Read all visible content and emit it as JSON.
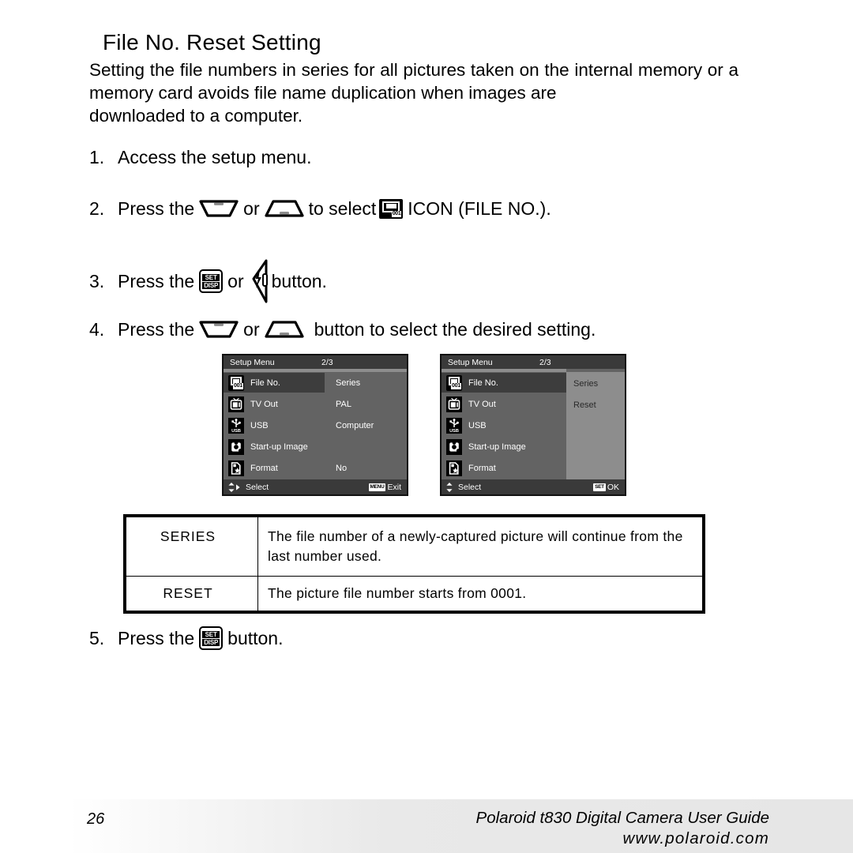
{
  "page": {
    "title": "File No. Reset Setting",
    "intro": "Setting the file numbers in series for all pictures taken on the internal memory or a memory card avoids file name duplication when images are",
    "intro_last": "downloaded to a computer."
  },
  "steps": [
    {
      "num": "1.",
      "text_a": "Access the setup menu.",
      "text_b": "",
      "text_c": ""
    },
    {
      "num": "2.",
      "text_a": "Press the",
      "text_b": "or",
      "text_c": "to select",
      "text_d": "ICON (FILE NO.)."
    },
    {
      "num": "3.",
      "text_a": "Press the",
      "text_b": "or",
      "text_c": "button."
    },
    {
      "num": "4.",
      "text_a": "Press the",
      "text_b": "or",
      "text_c": "button to select the desired setting."
    },
    {
      "num": "5.",
      "text_a": "Press the",
      "text_b": "button."
    }
  ],
  "buttons": {
    "set_line1": "SET",
    "set_line2": "DISP",
    "fileno_badge": "001"
  },
  "lcd_left": {
    "header_title": "Setup Menu",
    "page_indicator": "2/3",
    "rows": [
      {
        "icon": "file-no-icon",
        "label": "File No.",
        "value": "Series",
        "selected": true
      },
      {
        "icon": "tv-out-icon",
        "label": "TV Out",
        "value": "PAL",
        "selected": false
      },
      {
        "icon": "usb-icon",
        "label": "USB",
        "value": "Computer",
        "selected": false
      },
      {
        "icon": "startup-image-icon",
        "label": "Start-up Image",
        "value": "",
        "selected": false
      },
      {
        "icon": "format-icon",
        "label": "Format",
        "value": "No",
        "selected": false
      }
    ],
    "footer_select": "Select",
    "footer_key": "MENU",
    "footer_action": "Exit"
  },
  "lcd_right": {
    "header_title": "Setup Menu",
    "page_indicator": "2/3",
    "rows": [
      {
        "icon": "file-no-icon",
        "label": "File No.",
        "selected": true
      },
      {
        "icon": "tv-out-icon",
        "label": "TV Out",
        "selected": false
      },
      {
        "icon": "usb-icon",
        "label": "USB",
        "selected": false
      },
      {
        "icon": "startup-image-icon",
        "label": "Start-up Image",
        "selected": false
      },
      {
        "icon": "format-icon",
        "label": "Format",
        "selected": false
      }
    ],
    "submenu": {
      "option1": "Series",
      "option2": "Reset"
    },
    "footer_select": "Select",
    "footer_key": "SET",
    "footer_action": "OK"
  },
  "table": {
    "rows": [
      {
        "key": "SERIES",
        "value": "The file number of a newly-captured picture will continue from the last number used."
      },
      {
        "key": "RESET",
        "value": "The picture file number starts from 0001."
      }
    ]
  },
  "footer": {
    "page_number": "26",
    "guide_title": "Polaroid t830 Digital Camera User Guide",
    "website": "www.polaroid.com"
  }
}
